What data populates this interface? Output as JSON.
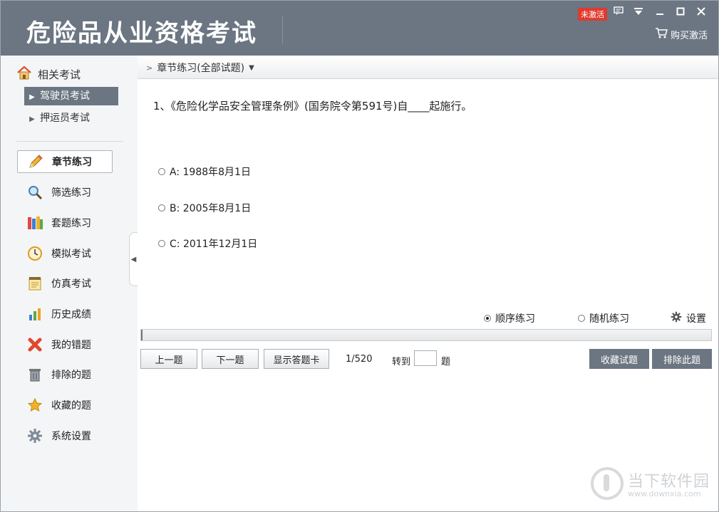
{
  "app": {
    "title": "危险品从业资格考试",
    "badge": "未激活",
    "buy_label": "购买激活"
  },
  "window_controls": [
    "chat-icon",
    "dropdown-icon",
    "minimize-icon",
    "maximize-icon",
    "close-icon"
  ],
  "sidebar": {
    "related_heading": "相关考试",
    "exam_types": [
      {
        "label": "驾驶员考试",
        "active": true
      },
      {
        "label": "押运员考试",
        "active": false
      }
    ],
    "nav": [
      {
        "label": "章节练习",
        "icon": "pencil-icon",
        "active": true
      },
      {
        "label": "筛选练习",
        "icon": "magnifier-icon",
        "active": false
      },
      {
        "label": "套题练习",
        "icon": "books-icon",
        "active": false
      },
      {
        "label": "模拟考试",
        "icon": "clock-icon",
        "active": false
      },
      {
        "label": "仿真考试",
        "icon": "notepad-icon",
        "active": false
      },
      {
        "label": "历史成绩",
        "icon": "bar-chart-icon",
        "active": false
      },
      {
        "label": "我的错题",
        "icon": "red-x-icon",
        "active": false
      },
      {
        "label": "排除的题",
        "icon": "trash-icon",
        "active": false
      },
      {
        "label": "收藏的题",
        "icon": "star-icon",
        "active": false
      },
      {
        "label": "系统设置",
        "icon": "gear-icon",
        "active": false
      }
    ]
  },
  "main": {
    "breadcrumb": "章节练习(全部试题)",
    "question": "1、《危险化学品安全管理条例》(国务院令第591号)自____起施行。",
    "options": [
      "A: 1988年8月1日",
      "B: 2005年8月1日",
      "C: 2011年12月1日"
    ],
    "modes": {
      "sequential": "顺序练习",
      "random": "随机练习",
      "settings": "设置",
      "selected": "sequential"
    },
    "progress": {
      "current": 1,
      "total": 520,
      "fraction": 0.0019
    },
    "buttons": {
      "prev": "上一题",
      "next": "下一题",
      "show_card": "显示答题卡",
      "favorite": "收藏试题",
      "exclude": "排除此题"
    },
    "counter": "1/520",
    "goto_label": "转到",
    "goto_value": "",
    "goto_suffix": "题"
  },
  "watermark": {
    "name": "当下软件园",
    "url": "www.downxia.com"
  },
  "colors": {
    "header": "#6b7682",
    "sidebar": "#f4f5f6",
    "badge": "#e03a2e"
  }
}
